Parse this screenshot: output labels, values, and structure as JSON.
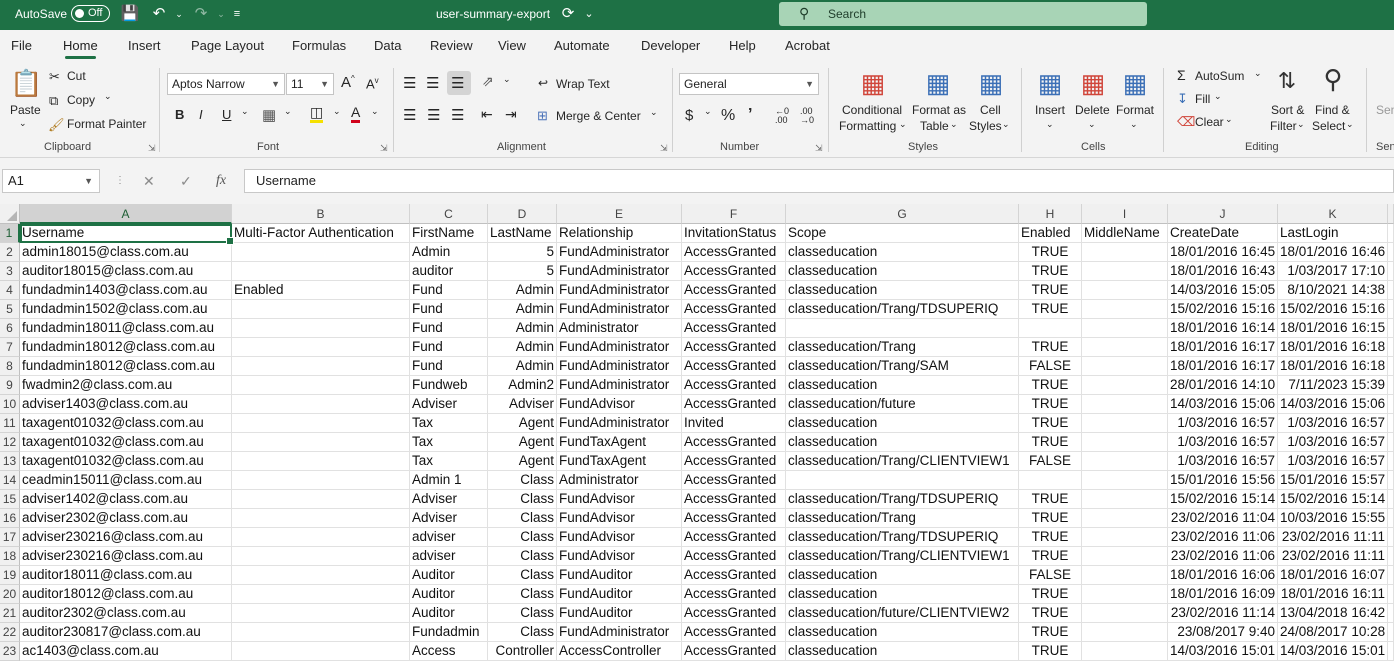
{
  "titlebar": {
    "autosave_label": "AutoSave",
    "autosave_state": "Off",
    "filename": "user-summary-export",
    "search_placeholder": "Search"
  },
  "tabs": [
    "File",
    "Home",
    "Insert",
    "Page Layout",
    "Formulas",
    "Data",
    "Review",
    "View",
    "Automate",
    "Developer",
    "Help",
    "Acrobat"
  ],
  "active_tab": "Home",
  "ribbon": {
    "clipboard": {
      "paste": "Paste",
      "cut": "Cut",
      "copy": "Copy",
      "format_painter": "Format Painter",
      "group": "Clipboard"
    },
    "font": {
      "name": "Aptos Narrow",
      "size": "11",
      "bold": "B",
      "italic": "I",
      "underline": "U",
      "group": "Font"
    },
    "alignment": {
      "wrap_text": "Wrap Text",
      "merge_center": "Merge & Center",
      "group": "Alignment"
    },
    "number": {
      "format": "General",
      "group": "Number"
    },
    "styles": {
      "conditional": "Conditional",
      "conditional2": "Formatting",
      "format_as": "Format as",
      "format_as2": "Table",
      "cell": "Cell",
      "cell2": "Styles",
      "group": "Styles"
    },
    "cells": {
      "insert": "Insert",
      "delete": "Delete",
      "format": "Format",
      "group": "Cells"
    },
    "editing": {
      "autosum": "AutoSum",
      "fill": "Fill",
      "clear": "Clear",
      "sort": "Sort &",
      "sort2": "Filter",
      "find": "Find &",
      "find2": "Select",
      "group": "Editing"
    },
    "sensitivity": {
      "label": "Sen",
      "group": "Sen"
    }
  },
  "formula_bar": {
    "name_box": "A1",
    "fx": "fx",
    "content": "Username"
  },
  "columns": [
    "A",
    "B",
    "C",
    "D",
    "E",
    "F",
    "G",
    "H",
    "I",
    "J",
    "K"
  ],
  "rows": [
    [
      "Username",
      "Multi-Factor Authentication",
      "FirstName",
      "LastName",
      "Relationship",
      "InvitationStatus",
      "Scope",
      "Enabled",
      "MiddleName",
      "CreateDate",
      "LastLogin"
    ],
    [
      "admin18015@class.com.au",
      "",
      "Admin",
      "5",
      "FundAdministrator",
      "AccessGranted",
      "classeducation",
      "TRUE",
      "",
      "18/01/2016 16:45",
      "18/01/2016 16:46"
    ],
    [
      "auditor18015@class.com.au",
      "",
      "auditor",
      "5",
      "FundAdministrator",
      "AccessGranted",
      "classeducation",
      "TRUE",
      "",
      "18/01/2016 16:43",
      "1/03/2017 17:10"
    ],
    [
      "fundadmin1403@class.com.au",
      "Enabled",
      "Fund",
      "Admin",
      "FundAdministrator",
      "AccessGranted",
      "classeducation",
      "TRUE",
      "",
      "14/03/2016 15:05",
      "8/10/2021 14:38"
    ],
    [
      "fundadmin1502@class.com.au",
      "",
      "Fund",
      "Admin",
      "FundAdministrator",
      "AccessGranted",
      "classeducation/Trang/TDSUPERIQ",
      "TRUE",
      "",
      "15/02/2016 15:16",
      "15/02/2016 15:16"
    ],
    [
      "fundadmin18011@class.com.au",
      "",
      "Fund",
      "Admin",
      "Administrator",
      "AccessGranted",
      "",
      "",
      "",
      "18/01/2016 16:14",
      "18/01/2016 16:15"
    ],
    [
      "fundadmin18012@class.com.au",
      "",
      "Fund",
      "Admin",
      "FundAdministrator",
      "AccessGranted",
      "classeducation/Trang",
      "TRUE",
      "",
      "18/01/2016 16:17",
      "18/01/2016 16:18"
    ],
    [
      "fundadmin18012@class.com.au",
      "",
      "Fund",
      "Admin",
      "FundAdministrator",
      "AccessGranted",
      "classeducation/Trang/SAM",
      "FALSE",
      "",
      "18/01/2016 16:17",
      "18/01/2016 16:18"
    ],
    [
      "fwadmin2@class.com.au",
      "",
      "Fundweb",
      "Admin2",
      "FundAdministrator",
      "AccessGranted",
      "classeducation",
      "TRUE",
      "",
      "28/01/2016 14:10",
      "7/11/2023 15:39"
    ],
    [
      "adviser1403@class.com.au",
      "",
      "Adviser",
      "Adviser",
      "FundAdvisor",
      "AccessGranted",
      "classeducation/future",
      "TRUE",
      "",
      "14/03/2016 15:06",
      "14/03/2016 15:06"
    ],
    [
      "taxagent01032@class.com.au",
      "",
      "Tax",
      "Agent",
      "FundAdministrator",
      "Invited",
      "classeducation",
      "TRUE",
      "",
      "1/03/2016 16:57",
      "1/03/2016 16:57"
    ],
    [
      "taxagent01032@class.com.au",
      "",
      "Tax",
      "Agent",
      "FundTaxAgent",
      "AccessGranted",
      "classeducation",
      "TRUE",
      "",
      "1/03/2016 16:57",
      "1/03/2016 16:57"
    ],
    [
      "taxagent01032@class.com.au",
      "",
      "Tax",
      "Agent",
      "FundTaxAgent",
      "AccessGranted",
      "classeducation/Trang/CLIENTVIEW1",
      "FALSE",
      "",
      "1/03/2016 16:57",
      "1/03/2016 16:57"
    ],
    [
      "ceadmin15011@class.com.au",
      "",
      "Admin 1",
      "Class",
      "Administrator",
      "AccessGranted",
      "",
      "",
      "",
      "15/01/2016 15:56",
      "15/01/2016 15:57"
    ],
    [
      "adviser1402@class.com.au",
      "",
      "Adviser",
      "Class",
      "FundAdvisor",
      "AccessGranted",
      "classeducation/Trang/TDSUPERIQ",
      "TRUE",
      "",
      "15/02/2016 15:14",
      "15/02/2016 15:14"
    ],
    [
      "adviser2302@class.com.au",
      "",
      "Adviser",
      "Class",
      "FundAdvisor",
      "AccessGranted",
      "classeducation/Trang",
      "TRUE",
      "",
      "23/02/2016 11:04",
      "10/03/2016 15:55"
    ],
    [
      "adviser230216@class.com.au",
      "",
      "adviser",
      "Class",
      "FundAdvisor",
      "AccessGranted",
      "classeducation/Trang/TDSUPERIQ",
      "TRUE",
      "",
      "23/02/2016 11:06",
      "23/02/2016 11:11"
    ],
    [
      "adviser230216@class.com.au",
      "",
      "adviser",
      "Class",
      "FundAdvisor",
      "AccessGranted",
      "classeducation/Trang/CLIENTVIEW1",
      "TRUE",
      "",
      "23/02/2016 11:06",
      "23/02/2016 11:11"
    ],
    [
      "auditor18011@class.com.au",
      "",
      "Auditor",
      "Class",
      "FundAuditor",
      "AccessGranted",
      "classeducation",
      "FALSE",
      "",
      "18/01/2016 16:06",
      "18/01/2016 16:07"
    ],
    [
      "auditor18012@class.com.au",
      "",
      "Auditor",
      "Class",
      "FundAuditor",
      "AccessGranted",
      "classeducation",
      "TRUE",
      "",
      "18/01/2016 16:09",
      "18/01/2016 16:11"
    ],
    [
      "auditor2302@class.com.au",
      "",
      "Auditor",
      "Class",
      "FundAuditor",
      "AccessGranted",
      "classeducation/future/CLIENTVIEW2",
      "TRUE",
      "",
      "23/02/2016 11:14",
      "13/04/2018 16:42"
    ],
    [
      "auditor230817@class.com.au",
      "",
      "Fundadmin",
      "Class",
      "FundAdministrator",
      "AccessGranted",
      "classeducation",
      "TRUE",
      "",
      "23/08/2017 9:40",
      "24/08/2017 10:28"
    ],
    [
      "ac1403@class.com.au",
      "",
      "Access",
      "Controller",
      "AccessController",
      "AccessGranted",
      "classeducation",
      "TRUE",
      "",
      "14/03/2016 15:01",
      "14/03/2016 15:01"
    ]
  ],
  "colors": {
    "accent": "#1e7145",
    "ribbon_bg": "#f3f3f3",
    "search_bg": "#a8d4b6"
  }
}
